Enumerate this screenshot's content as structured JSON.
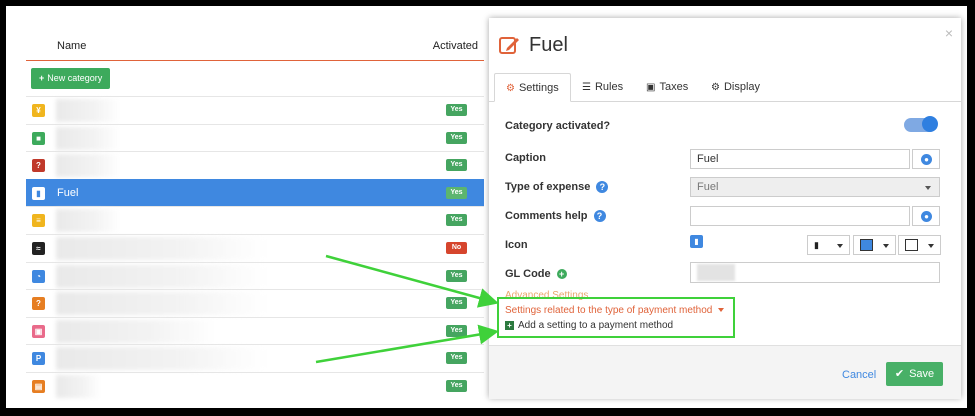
{
  "list": {
    "header_name": "Name",
    "header_activated": "Activated",
    "new_category_label": "New category",
    "rows": [
      {
        "icon": "utensils-icon",
        "color": "#f0b51e",
        "glyph": "¥",
        "name": "",
        "status": "Yes"
      },
      {
        "icon": "car-icon",
        "color": "#3daa5c",
        "glyph": "■",
        "name": "",
        "status": "Yes"
      },
      {
        "icon": "question-icon",
        "color": "#c0392b",
        "glyph": "?",
        "name": "",
        "status": "Yes"
      },
      {
        "icon": "fuel-icon",
        "color": "#3f88e0",
        "glyph": "▮",
        "name": "Fuel",
        "status": "Yes",
        "selected": true
      },
      {
        "icon": "bed-icon",
        "color": "#f0b51e",
        "glyph": "≡",
        "name": "",
        "status": "Yes"
      },
      {
        "icon": "wifi-icon",
        "color": "#222222",
        "glyph": "≈",
        "name": "",
        "status": "No"
      },
      {
        "icon": "gauge-icon",
        "color": "#3f88e0",
        "glyph": "◔",
        "name": "",
        "status": "Yes"
      },
      {
        "icon": "question-icon",
        "color": "#e67e22",
        "glyph": "?",
        "name": "",
        "status": "Yes"
      },
      {
        "icon": "money-icon",
        "color": "#e96a8a",
        "glyph": "▣",
        "name": "",
        "status": "Yes"
      },
      {
        "icon": "parking-icon",
        "color": "#3f88e0",
        "glyph": "P",
        "name": "",
        "status": "Yes"
      },
      {
        "icon": "briefcase-icon",
        "color": "#e67e22",
        "glyph": "▤",
        "name": "",
        "status": "Yes"
      }
    ]
  },
  "modal": {
    "title": "Fuel",
    "close": "×",
    "tabs": [
      {
        "label": "Settings",
        "icon": "gear-icon",
        "glyph": "⚙"
      },
      {
        "label": "Rules",
        "icon": "sliders-icon",
        "glyph": "☰"
      },
      {
        "label": "Taxes",
        "icon": "money-icon",
        "glyph": "▣"
      },
      {
        "label": "Display",
        "icon": "cogs-icon",
        "glyph": "⚙"
      }
    ],
    "fields": {
      "activated_label": "Category activated?",
      "caption_label": "Caption",
      "caption_value": "Fuel",
      "type_label": "Type of expense",
      "type_value": "Fuel",
      "comments_label": "Comments help",
      "comments_value": "",
      "icon_label": "Icon",
      "gl_label": "GL Code"
    },
    "advanced_settings": "Advanced Settings",
    "payment_settings": "Settings related to the type of payment method",
    "add_payment_setting": "Add a setting to a payment method",
    "cancel_label": "Cancel",
    "save_label": "Save"
  },
  "colors": {
    "accent_orange": "#e0633a",
    "selected_blue": "#3f88e0",
    "green": "#3daa5c",
    "highlight_green": "#3fd13a"
  }
}
